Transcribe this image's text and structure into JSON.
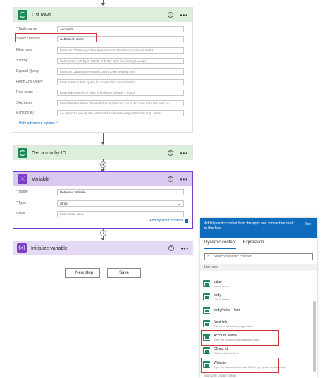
{
  "list_rows": {
    "title": "List rows",
    "fields": [
      {
        "label": "* Table name",
        "value": "Accounts",
        "placeholder": ""
      },
      {
        "label": "Select columns",
        "value": "websiteurl, name",
        "placeholder": ""
      },
      {
        "label": "Filter rows",
        "value": "",
        "placeholder": "Enter an OData style filter expression to limit which rows are listed"
      },
      {
        "label": "Sort By",
        "value": "",
        "placeholder": "Columns to sort by in OData orderBy style (excluding lookups)"
      },
      {
        "label": "Expand Query",
        "value": "",
        "placeholder": "Enter an Odata style expand query to list related rows"
      },
      {
        "label": "Fetch Xml Query",
        "value": "",
        "placeholder": "Enter a Fetch XML query for advanced customization"
      },
      {
        "label": "Row count",
        "value": "",
        "placeholder": "Enter the number of rows to be listed (default = 5000)"
      },
      {
        "label": "Skip token",
        "value": "",
        "placeholder": "Enter the skip token obtained from a previous run to list rows from the next pa"
      },
      {
        "label": "Partition ID",
        "value": "",
        "placeholder": "An option to specify the partitionId while retrieving data for NoSQL tables"
      }
    ],
    "hide_advanced": "Hide advanced options"
  },
  "get_row": {
    "title": "Get a row by ID"
  },
  "variable": {
    "title": "Variable",
    "name_label": "* Name",
    "name_value": "Retrieved Variable",
    "type_label": "* Type",
    "type_value": "String",
    "value_label": "Value",
    "value_placeholder": "Enter initial value",
    "add_dynamic": "Add dynamic content"
  },
  "init_var": {
    "title": "Initialize variable"
  },
  "buttons": {
    "new_step": "+ New step",
    "save": "Save"
  },
  "panel": {
    "intro": "Add dynamic content from the apps and connectors used in this flow.",
    "hide": "Hide",
    "tab_dynamic": "Dynamic content",
    "tab_expression": "Expression",
    "search_placeholder": "Search dynamic content",
    "section": "List rows",
    "items": [
      {
        "name": "value",
        "desc": "List of Items"
      },
      {
        "name": "body",
        "desc": "List of Tables"
      },
      {
        "name": "body/value - Item",
        "desc": ""
      },
      {
        "name": "Next link",
        "desc": "The url to fetch next page data."
      },
      {
        "name": "Account Name",
        "desc": "Type the company or business name."
      },
      {
        "name": "OData Id",
        "desc": "OData Id of the Item"
      },
      {
        "name": "Website",
        "desc": "Type the account's website URL to get quick details abou..."
      }
    ],
    "footer": "Manually trigger a flow"
  },
  "colors": {
    "accent": "#0f6cbd",
    "highlight": "#d13438",
    "variable": "#7a3ec9",
    "dataverse": "#1b8a5a"
  }
}
